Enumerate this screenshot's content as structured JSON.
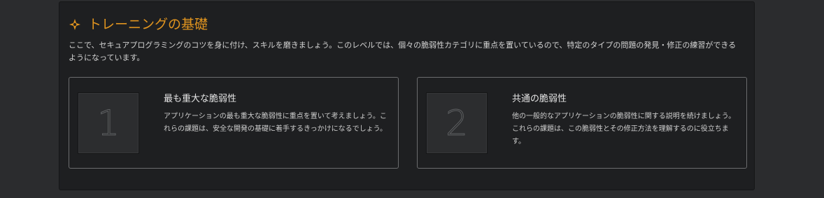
{
  "section": {
    "title": "トレーニングの基礎",
    "icon": "compass-star-icon",
    "accent_color": "#e0941f",
    "description": "ここで、セキュアプログラミングのコツを身に付け、スキルを磨きましょう。このレベルでは、個々の脆弱性カテゴリに重点を置いているので、特定のタイプの問題の発見・修正の練習ができるようになっています。"
  },
  "cards": [
    {
      "number": "1",
      "title": "最も重大な脆弱性",
      "text": "アプリケーションの最も重大な脆弱性に重点を置いて考えましょう。これらの課題は、安全な開発の基礎に着手するきっかけになるでしょう。"
    },
    {
      "number": "2",
      "title": "共通の脆弱性",
      "text": "他の一般的なアプリケーションの脆弱性に関する説明を続けましょう。これらの課題は、この脆弱性とその修正方法を理解するのに役立ちます。"
    }
  ]
}
